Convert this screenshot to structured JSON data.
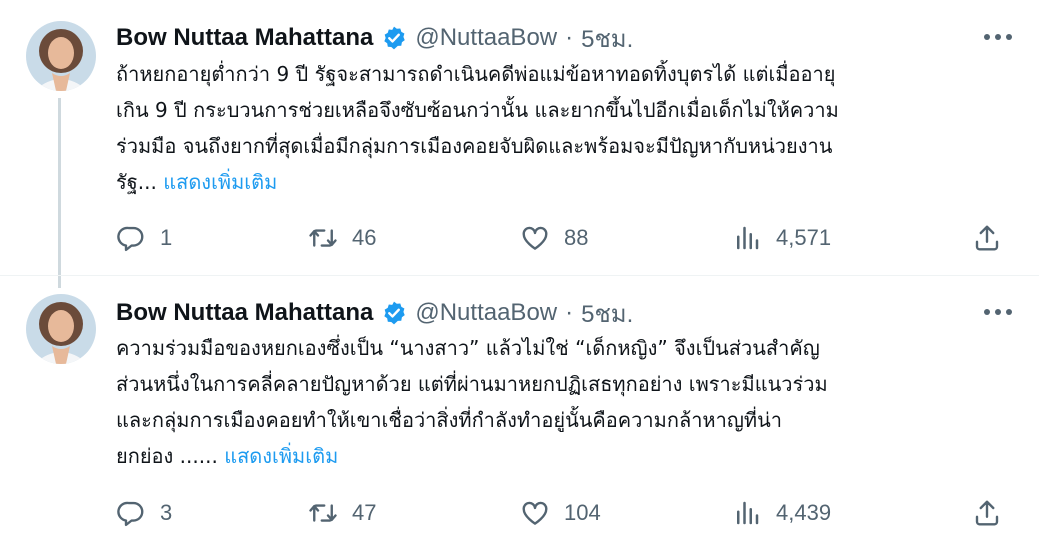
{
  "posts": [
    {
      "author_name": "Bow Nuttaa Mahattana",
      "handle": "@NuttaaBow",
      "separator": "·",
      "time": "5ชม.",
      "lines": [
        "ถ้าหยกอายุต่ำกว่า 9 ปี รัฐจะสามารถดำเนินคดีพ่อแม่ข้อหาทอดทิ้งบุตรได้ แต่เมื่ออายุ",
        "เกิน 9 ปี กระบวนการช่วยเหลือจึงซับซ้อนกว่านั้น และยากขึ้นไปอีกเมื่อเด็กไม่ให้ความ",
        "ร่วมมือ จนถึงยากที่สุดเมื่อมีกลุ่มการเมืองคอยจับผิดและพร้อมจะมีปัญหากับหน่วยงาน",
        "รัฐ..."
      ],
      "show_more": "แสดงเพิ่มเติม",
      "replies": "1",
      "reposts": "46",
      "likes": "88",
      "views": "4,571"
    },
    {
      "author_name": "Bow Nuttaa Mahattana",
      "handle": "@NuttaaBow",
      "separator": "·",
      "time": "5ชม.",
      "lines": [
        "ความร่วมมือของหยกเองซึ่งเป็น “นางสาว” แล้วไม่ใช่ “เด็กหญิง” จึงเป็นส่วนสำคัญ",
        "ส่วนหนึ่งในการคลี่คลายปัญหาด้วย แต่ที่ผ่านมาหยกปฏิเสธทุกอย่าง เพราะมีแนวร่วม",
        "และกลุ่มการเมืองคอยทำให้เขาเชื่อว่าสิ่งที่กำลังทำอยู่นั้นคือความกล้าหาญที่น่า",
        "ยกย่อง ......"
      ],
      "show_more": "แสดงเพิ่มเติม",
      "replies": "3",
      "reposts": "47",
      "likes": "104",
      "views": "4,439"
    }
  ],
  "icons": {
    "verified": "verified-badge-icon",
    "more": "more-dots-icon",
    "reply": "reply-icon",
    "repost": "repost-icon",
    "like": "heart-icon",
    "views": "views-chart-icon",
    "share": "share-icon"
  },
  "colors": {
    "text": "#0f1419",
    "secondary": "#536471",
    "accent": "#1d9bf0",
    "thread_line": "#cfd9de"
  }
}
